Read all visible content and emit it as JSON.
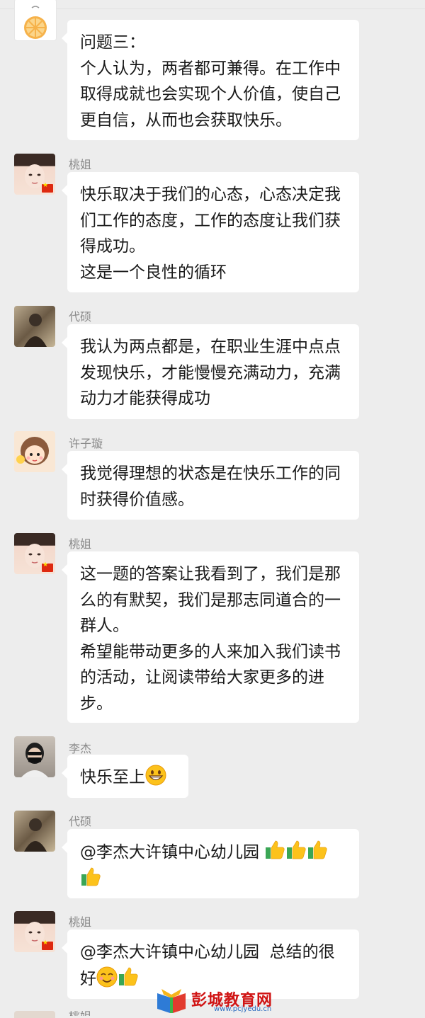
{
  "messages": [
    {
      "sender": "",
      "text": "问题三：\n个人认为，两者都可兼得。在工作中取得成就也会实现个人价值，使自己更自信，从而也会获取快乐。"
    },
    {
      "sender": "桃姐",
      "text": "快乐取决于我们的心态，心态决定我们工作的态度，工作的态度让我们获得成功。\n这是一个良性的循环"
    },
    {
      "sender": "代硕",
      "text": "我认为两点都是，在职业生涯中点点发现快乐，才能慢慢充满动力，充满动力才能获得成功"
    },
    {
      "sender": "许子璇",
      "text": "我觉得理想的状态是在快乐工作的同时获得价值感。"
    },
    {
      "sender": "桃姐",
      "text": "这一题的答案让我看到了，我们是那么的有默契，我们是那志同道合的一群人。\n希望能带动更多的人来加入我们读书的活动，让阅读带给大家更多的进步。"
    },
    {
      "sender": "李杰",
      "text": "快乐至上"
    },
    {
      "sender": "代硕",
      "text": "@李杰大许镇中心幼儿园 "
    },
    {
      "sender": "桃姐",
      "text": "@李杰大许镇中心幼儿园  总结的很好"
    },
    {
      "sender": "桃姐"
    }
  ],
  "watermark": {
    "name": "彭城教育网",
    "url": "www.pcjyedu.cn"
  },
  "icons": {
    "orange-avatar": "orange-slice",
    "grin-emoji": "grinning-face",
    "smile-emoji": "smiling-face",
    "thumbs-up": "thumbs-up"
  }
}
